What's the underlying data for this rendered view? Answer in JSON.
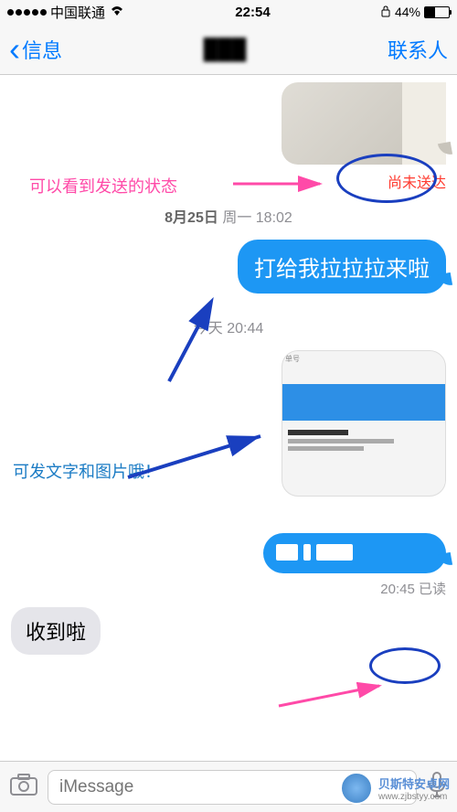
{
  "status_bar": {
    "carrier": "中国联通",
    "time": "22:54",
    "battery_pct": "44%"
  },
  "nav": {
    "back_label": "信息",
    "title": "███",
    "right_label": "联系人"
  },
  "messages": {
    "not_delivered": "尚未送达",
    "timestamp1_date": "8月25日",
    "timestamp1_day": "周一",
    "timestamp1_time": "18:02",
    "bubble1": "打给我拉拉拉来啦",
    "timestamp2": "今天 20:44",
    "read_receipt_time": "20:45",
    "read_receipt_label": "已读",
    "received1": "收到啦"
  },
  "annotations": {
    "pink1": "可以看到发送的状态",
    "blue1": "可发文字和图片哦！"
  },
  "input": {
    "placeholder": "iMessage"
  },
  "watermark": {
    "name": "贝斯特安卓网",
    "url": "www.zjbstyy.com"
  }
}
